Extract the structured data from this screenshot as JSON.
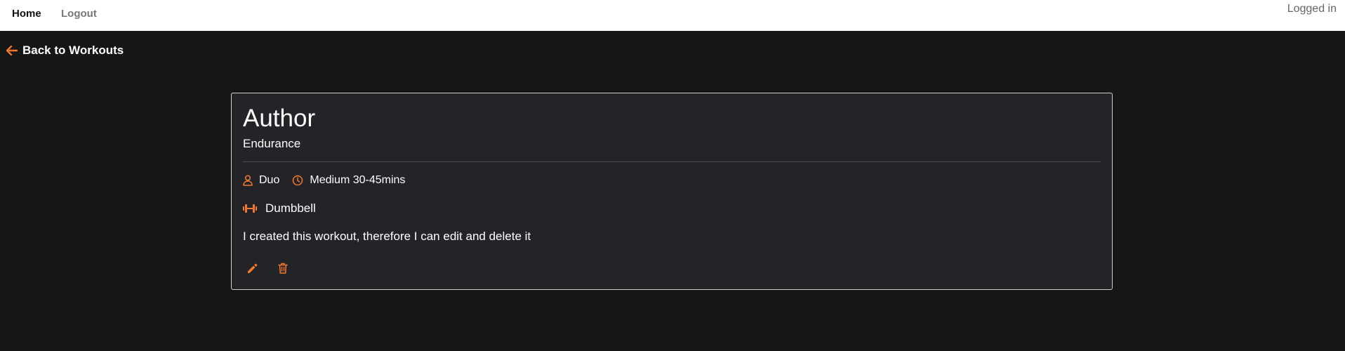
{
  "nav": {
    "home_label": "Home",
    "logout_label": "Logout",
    "status_text": "Logged in"
  },
  "back": {
    "label": "Back to Workouts",
    "icon": "arrow-left-icon"
  },
  "workout": {
    "title": "Author",
    "category": "Endurance",
    "group_size": "Duo",
    "duration": "Medium 30-45mins",
    "equipment": "Dumbbell",
    "description": "I created this workout, therefore I can edit and delete it"
  },
  "icons": {
    "group": "person-icon",
    "duration": "clock-icon",
    "equipment": "dumbbell-icon",
    "edit": "pencil-icon",
    "delete": "trash-icon"
  },
  "colors": {
    "accent": "#f2792b",
    "background": "#161616",
    "card": "#232427",
    "navbar": "#ffffff"
  }
}
